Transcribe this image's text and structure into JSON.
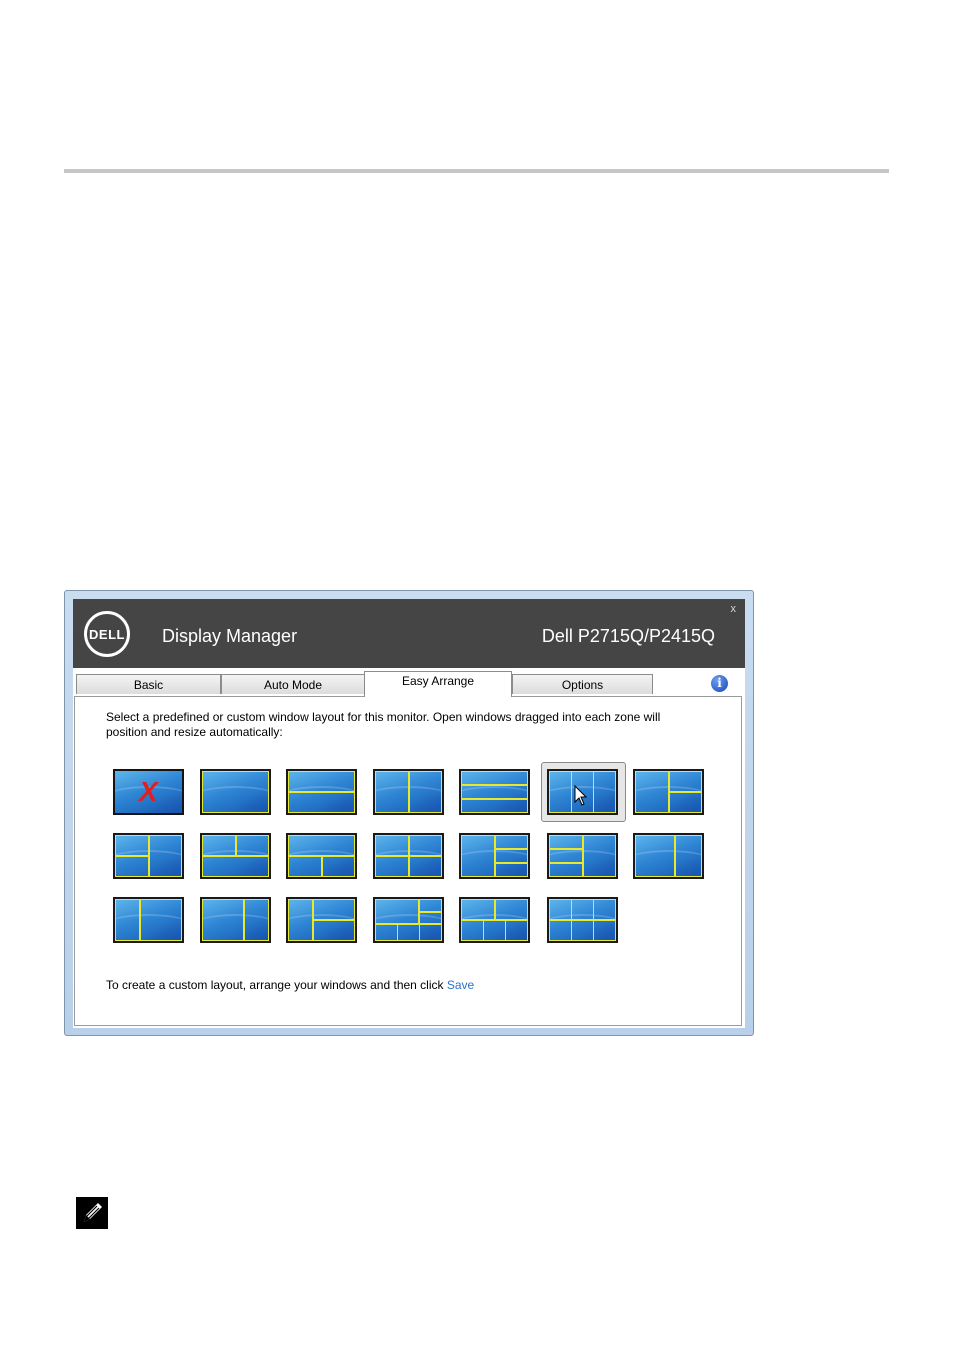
{
  "window": {
    "app_title": "Display Manager",
    "model": "Dell P2715Q/P2415Q",
    "close_label": "x",
    "logo_text": "DELL",
    "info_glyph": "i"
  },
  "tabs": [
    {
      "label": "Basic",
      "active": false
    },
    {
      "label": "Auto Mode",
      "active": false
    },
    {
      "label": "Easy Arrange",
      "active": true
    },
    {
      "label": "Options",
      "active": false
    }
  ],
  "easy_arrange": {
    "description": "Select a predefined or custom window layout for this monitor. Open windows dragged into each zone will position and resize automatically:",
    "footer_text": "To create a custom layout, arrange your windows and then click ",
    "save_link": "Save",
    "none_glyph": "X",
    "selected_layout": "three-columns",
    "layouts": [
      "none",
      "full",
      "two-rows",
      "two-columns",
      "three-rows",
      "three-columns",
      "left-half-right-split",
      "left-split-right-wide",
      "top-split-bottom",
      "top-bottom-split",
      "quad",
      "left-wide-right-three",
      "left-three-right-wide",
      "left-wide-right-two",
      "left-narrow-right-wide",
      "left-wide-right-narrow",
      "narrow-left-two-right",
      "top-wide-bottom-three",
      "top-two-bottom-three",
      "six-grid"
    ]
  },
  "colors": {
    "titlebar": "#454545",
    "zone_line": "#e8e82e",
    "thumb_blue": "#2f86d4",
    "link": "#2a72c7"
  },
  "icons": [
    "dell-logo-icon",
    "info-icon",
    "close-icon",
    "mouse-cursor-icon",
    "note-pencil-icon"
  ]
}
